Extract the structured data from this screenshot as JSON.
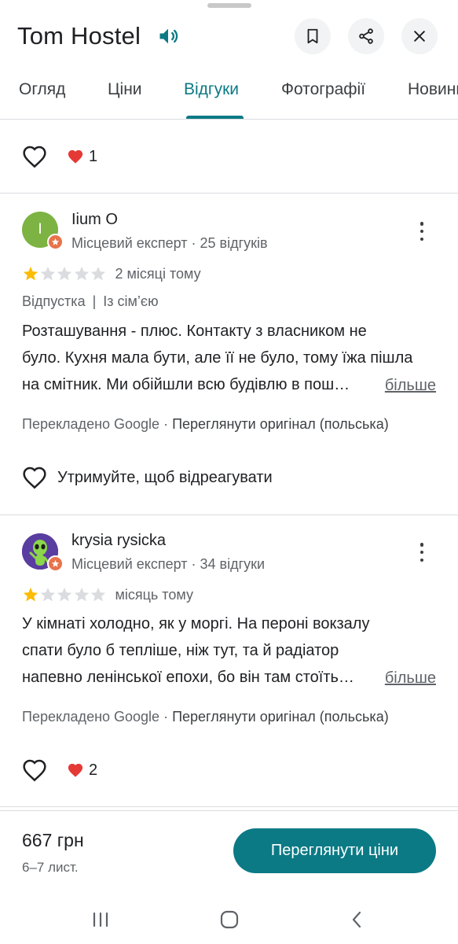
{
  "header": {
    "title": "Tom Hostel",
    "icons": [
      "speaker-icon",
      "bookmark-icon",
      "share-icon",
      "close-icon"
    ]
  },
  "tabs": [
    {
      "label": "Огляд",
      "active": false
    },
    {
      "label": "Ціни",
      "active": false
    },
    {
      "label": "Відгуки",
      "active": true
    },
    {
      "label": "Фотографії",
      "active": false
    },
    {
      "label": "Новини",
      "active": false
    }
  ],
  "top_reaction": {
    "count": "1"
  },
  "reviews": [
    {
      "author": "Iium O",
      "avatar_letter": "I",
      "avatar_color": "#7cb342",
      "meta": "Місцевий експерт · 25 відгуків",
      "rating": 1,
      "rating_max": 5,
      "date": "2 місяці тому",
      "tags": [
        "Відпустка",
        "Із сім’єю"
      ],
      "text_lines": [
        "Розташування - плюс. Контакту з власником не",
        "було. Кухня мала бути, але її не було, тому їжа пішла",
        "на смітник. Ми обійшли всю будівлю в пош…"
      ],
      "more_label": "більше",
      "translated_prefix": "Перекладено Google · ",
      "translated_link": "Переглянути оригінал (польська)",
      "hold_label": "Утримуйте, щоб відреагувати"
    },
    {
      "author": "krysia rysicka",
      "meta": "Місцевий експерт · 34 відгуки",
      "rating": 1,
      "rating_max": 5,
      "date": "місяць тому",
      "text_lines": [
        "У кімнаті холодно, як у моргі. На пероні вокзалу",
        "спати було б тепліше, ніж тут, та й радіатор",
        "напевно ленінської епохи, бо він там стоїть…"
      ],
      "more_label": "більше",
      "translated_prefix": "Перекладено Google · ",
      "translated_link": "Переглянути оригінал (польська)",
      "reaction_count": "2"
    }
  ],
  "bottom_bar": {
    "price": "667 грн",
    "dates": "6–7 лист.",
    "cta_label": "Переглянути ціни"
  },
  "colors": {
    "accent": "#0b7a85",
    "star_filled": "#fbbc04",
    "star_empty": "#dadce0",
    "heart": "#e53935",
    "badge": "#e8734a"
  }
}
